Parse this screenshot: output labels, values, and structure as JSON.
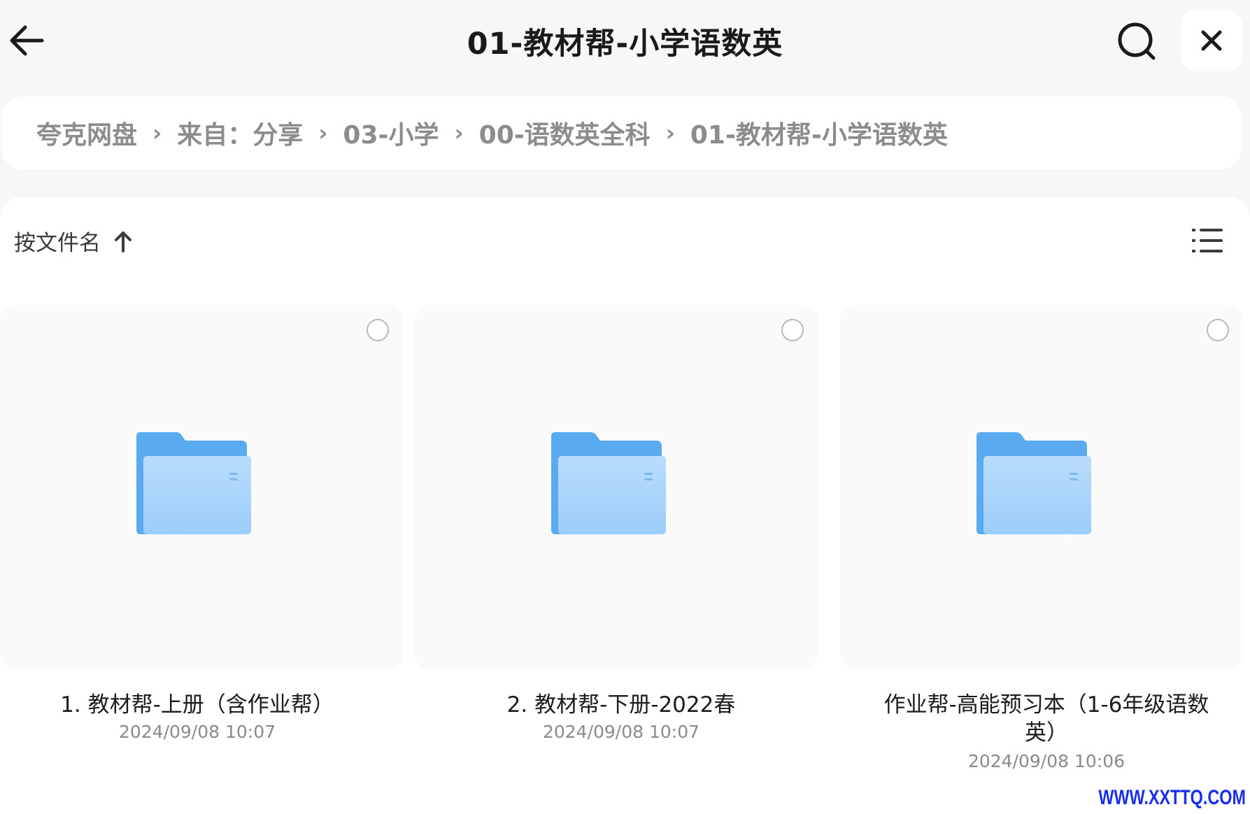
{
  "header": {
    "title": "01-教材帮-小学语数英",
    "back_icon": "arrow-left-icon",
    "search_icon": "search-icon",
    "close_icon": "close-icon"
  },
  "breadcrumb": {
    "items": [
      "夸克网盘",
      "来自：分享",
      "03-小学",
      "00-语数英全科",
      "01-教材帮-小学语数英"
    ],
    "separator": "›"
  },
  "toolbar": {
    "sort_label": "按文件名",
    "sort_icon": "arrow-up-icon",
    "view_icon": "list-view-icon"
  },
  "files": [
    {
      "name": "1. 教材帮-上册（含作业帮）",
      "date": "2024/09/08 10:07",
      "icon": "folder-icon"
    },
    {
      "name": "2. 教材帮-下册-2022春",
      "date": "2024/09/08 10:07",
      "icon": "folder-icon"
    },
    {
      "name": "作业帮-高能预习本（1-6年级语数英）",
      "name_line1": "作业帮-高能预习本（1-6年级语数",
      "name_line2": "英）",
      "date": "2024/09/08 10:06",
      "icon": "folder-icon"
    }
  ],
  "watermark": "WWW.XXTTQ.COM",
  "colors": {
    "folder_back": "#5aaaf0",
    "folder_front": "#a9d3fb",
    "background": "#f7f7f8",
    "watermark": "#1a2ef0"
  }
}
